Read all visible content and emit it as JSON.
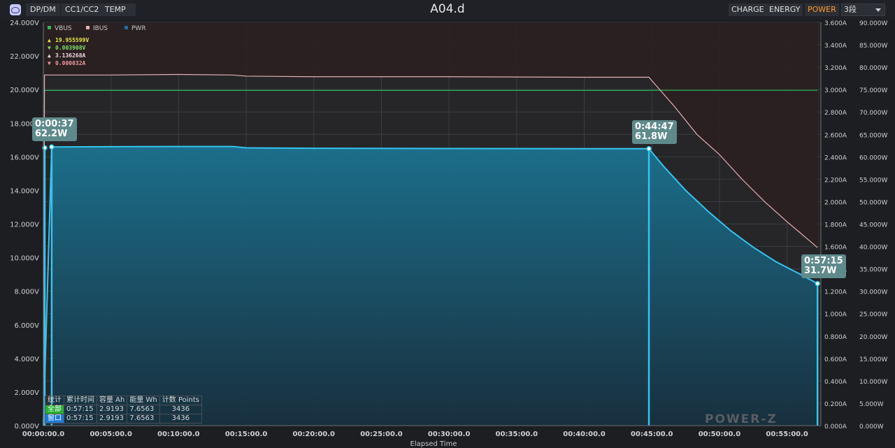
{
  "toolbar": {
    "left_buttons": [
      "DP/DM",
      "CC1/CC2",
      "TEMP"
    ],
    "title": "A04.d",
    "right_buttons": [
      "CHARGE",
      "ENERGY",
      "POWER"
    ],
    "active_button": "POWER",
    "select_value": "3段"
  },
  "colors": {
    "vbus": "#2fb25a",
    "ibus": "#e7aeb4",
    "pwr": "#36c3f0",
    "accent": "#ff9a2e"
  },
  "legend": [
    {
      "name": "VBUS",
      "color": "#2fb25a"
    },
    {
      "name": "IBUS",
      "color": "#e7aeb4"
    },
    {
      "name": "PWR",
      "color": "#1a6fa0"
    }
  ],
  "readouts": [
    {
      "arrow": "▲",
      "value": "19.955599V",
      "color": "#e8e84a"
    },
    {
      "arrow": "▼",
      "value": "0.003908V",
      "color": "#7fe06a"
    },
    {
      "arrow": "▲",
      "value": "3.136268A",
      "color": "#f0d8dc"
    },
    {
      "arrow": "▼",
      "value": "0.000032A",
      "color": "#f09aa0"
    }
  ],
  "callouts": [
    {
      "time": "0:00:37",
      "power": "62.2W",
      "t": 37,
      "p": 62.2
    },
    {
      "time": "0:44:47",
      "power": "61.8W",
      "t": 2687,
      "p": 61.8
    },
    {
      "time": "0:57:15",
      "power": "31.7W",
      "t": 3435,
      "p": 31.7
    }
  ],
  "stats": {
    "headers": [
      "统计",
      "累计时间",
      "容量 Ah",
      "能量 Wh",
      "计数 Points"
    ],
    "rows": [
      [
        "全部",
        "0:57:15",
        "2.9193",
        "7.6563",
        "3436"
      ],
      [
        "窗口",
        "0:57:15",
        "2.9193",
        "7.6563",
        "3436"
      ]
    ]
  },
  "brand": "POWER-Z",
  "chart_data": {
    "type": "line",
    "xlabel": "Elapsed Time",
    "xlim": [
      "00:00:00.0",
      "00:57:30.0"
    ],
    "x_tick_labels": [
      "00:00:00.0",
      "00:05:00.0",
      "00:10:00.0",
      "00:15:00.0",
      "00:20:00.0",
      "00:25:00.0",
      "00:30:00.0",
      "00:35:00.0",
      "00:40:00.0",
      "00:45:00.0",
      "00:50:00.0",
      "00:55:00.0"
    ],
    "y_left": {
      "unit": "V",
      "ylim": [
        0,
        24
      ],
      "tick_labels": [
        "0.000V",
        "2.000V",
        "4.000V",
        "6.000V",
        "8.000V",
        "10.000V",
        "12.000V",
        "14.000V",
        "16.000V",
        "18.000V",
        "20.000V",
        "22.000V",
        "24.000V"
      ]
    },
    "y_right_current": {
      "unit": "A",
      "ylim": [
        0,
        3.6
      ],
      "tick_labels": [
        "0.000A",
        "0.200A",
        "0.400A",
        "0.600A",
        "0.800A",
        "1.000A",
        "1.200A",
        "1.400A",
        "1.600A",
        "1.800A",
        "2.000A",
        "2.200A",
        "2.400A",
        "2.600A",
        "2.800A",
        "3.000A",
        "3.200A",
        "3.400A",
        "3.600A"
      ]
    },
    "y_right_power": {
      "unit": "W",
      "ylim": [
        0,
        90
      ],
      "tick_labels": [
        "0.000W",
        "5.000W",
        "10.000W",
        "15.000W",
        "20.000W",
        "25.000W",
        "30.000W",
        "35.000W",
        "40.000W",
        "45.000W",
        "50.000W",
        "55.000W",
        "60.000W",
        "65.000W",
        "70.000W",
        "75.000W",
        "80.000W",
        "85.000W",
        "90.000W"
      ]
    },
    "grid": true,
    "legend_position": "top-left",
    "series": [
      {
        "name": "VBUS",
        "unit": "V",
        "points": [
          [
            0,
            0
          ],
          [
            5,
            19.95
          ],
          [
            600,
            19.95
          ],
          [
            1200,
            19.95
          ],
          [
            1800,
            19.95
          ],
          [
            2400,
            19.95
          ],
          [
            2687,
            19.95
          ],
          [
            2700,
            19.96
          ],
          [
            3000,
            19.96
          ],
          [
            3435,
            19.96
          ]
        ]
      },
      {
        "name": "IBUS",
        "unit": "A",
        "points": [
          [
            0,
            0
          ],
          [
            5,
            3.13
          ],
          [
            300,
            3.13
          ],
          [
            600,
            3.135
          ],
          [
            840,
            3.13
          ],
          [
            900,
            3.12
          ],
          [
            1200,
            3.115
          ],
          [
            1800,
            3.115
          ],
          [
            2400,
            3.11
          ],
          [
            2687,
            3.11
          ],
          [
            2700,
            3.08
          ],
          [
            2800,
            2.85
          ],
          [
            2900,
            2.6
          ],
          [
            3000,
            2.42
          ],
          [
            3100,
            2.2
          ],
          [
            3200,
            2.0
          ],
          [
            3300,
            1.82
          ],
          [
            3400,
            1.65
          ],
          [
            3435,
            1.59
          ]
        ]
      },
      {
        "name": "PWR",
        "unit": "W",
        "points": [
          [
            0,
            0
          ],
          [
            37,
            62.2
          ],
          [
            300,
            62.25
          ],
          [
            600,
            62.3
          ],
          [
            840,
            62.3
          ],
          [
            900,
            62.0
          ],
          [
            1200,
            61.9
          ],
          [
            1800,
            61.85
          ],
          [
            2400,
            61.8
          ],
          [
            2687,
            61.8
          ],
          [
            2750,
            58
          ],
          [
            2850,
            52.5
          ],
          [
            2950,
            47.8
          ],
          [
            3050,
            43.5
          ],
          [
            3150,
            39.8
          ],
          [
            3250,
            36.6
          ],
          [
            3350,
            34.0
          ],
          [
            3435,
            31.7
          ]
        ]
      }
    ]
  }
}
